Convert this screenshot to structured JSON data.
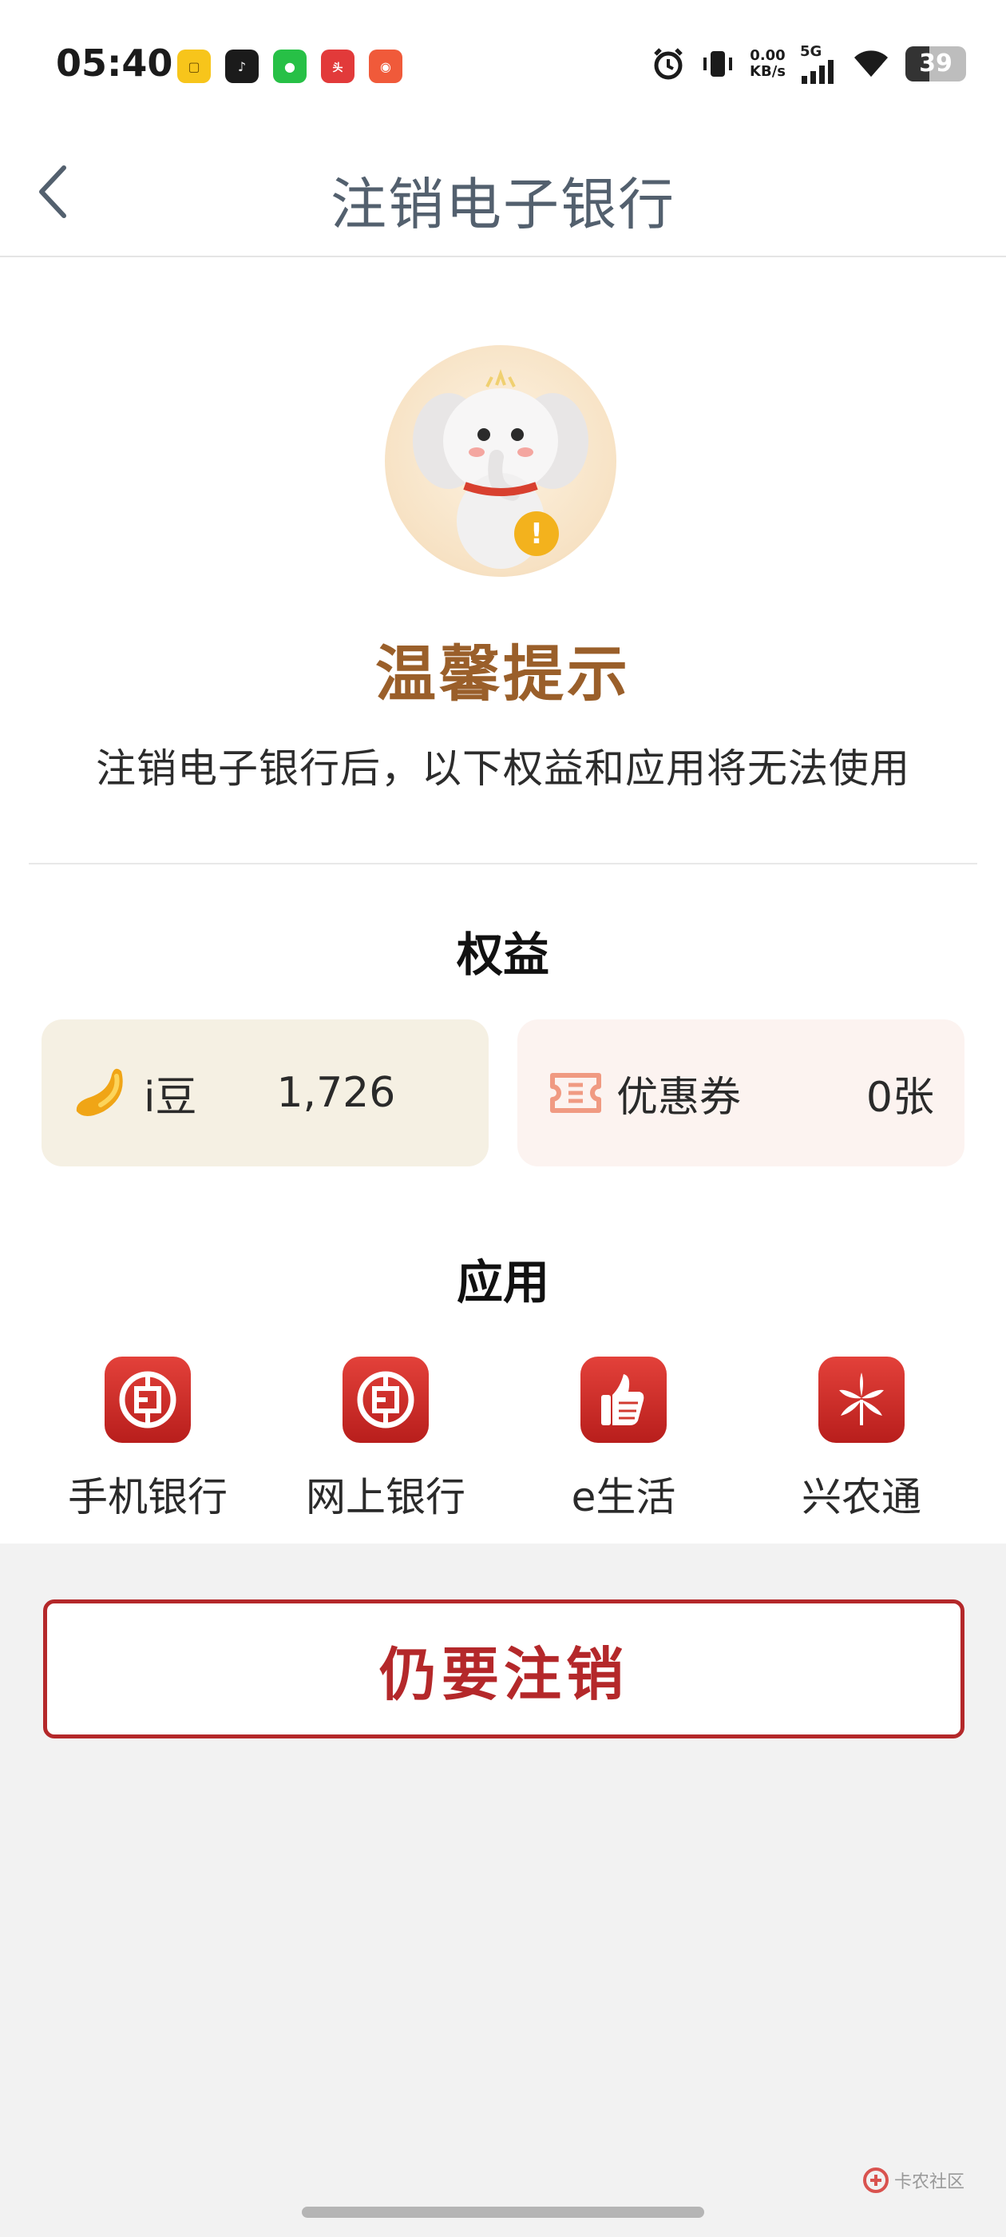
{
  "status_bar": {
    "time": "05:40",
    "speed_value": "0.00",
    "speed_unit": "KB/s",
    "network": "5G",
    "battery": "39",
    "battery_level": 0.39
  },
  "header": {
    "title": "注销电子银行"
  },
  "notice": {
    "title": "温馨提示",
    "description": "注销电子银行后，以下权益和应用将无法使用"
  },
  "benefits": {
    "section_title": "权益",
    "beans_label": "i豆",
    "beans_value": "1,726",
    "coupon_label": "优惠券",
    "coupon_value": "0张"
  },
  "apps": {
    "section_title": "应用",
    "items": [
      {
        "label": "手机银行",
        "icon": "icbc-logo-icon"
      },
      {
        "label": "网上银行",
        "icon": "icbc-logo-icon"
      },
      {
        "label": "e生活",
        "icon": "thumbs-up-icon"
      },
      {
        "label": "兴农通",
        "icon": "flower-icon"
      }
    ]
  },
  "actions": {
    "cancel_label": "仍要注销"
  },
  "watermark": {
    "text": "卡农社区"
  },
  "colors": {
    "accent_red": "#b4282a",
    "title_brown": "#9a5f2a",
    "highlight": "#f6d79a"
  }
}
